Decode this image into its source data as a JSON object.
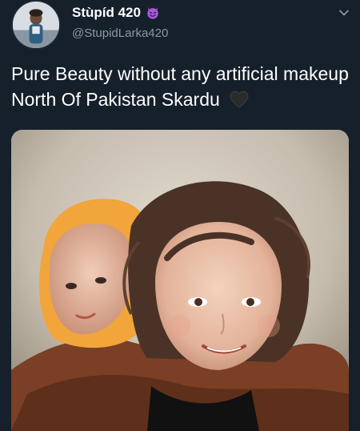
{
  "author": {
    "display_name": "Stùpíd 420",
    "name_emoji_icon": "smiling-devil-icon",
    "handle": "@StupidLarka420",
    "avatar_icon": "profile-avatar"
  },
  "tweet": {
    "text": "Pure Beauty without any artificial makeup North Of Pakistan Skardu",
    "trailing_emoji_icon": "black-heart-icon"
  },
  "menu": {
    "icon": "chevron-down-icon"
  },
  "media": {
    "type": "photo",
    "subject": "two children, a smiling girl carrying a baby in a yellow headscarf"
  },
  "colors": {
    "background": "#15202b",
    "primary_text": "#ffffff",
    "secondary_text": "#8899a6",
    "accent_emoji": "#a45bd6"
  }
}
